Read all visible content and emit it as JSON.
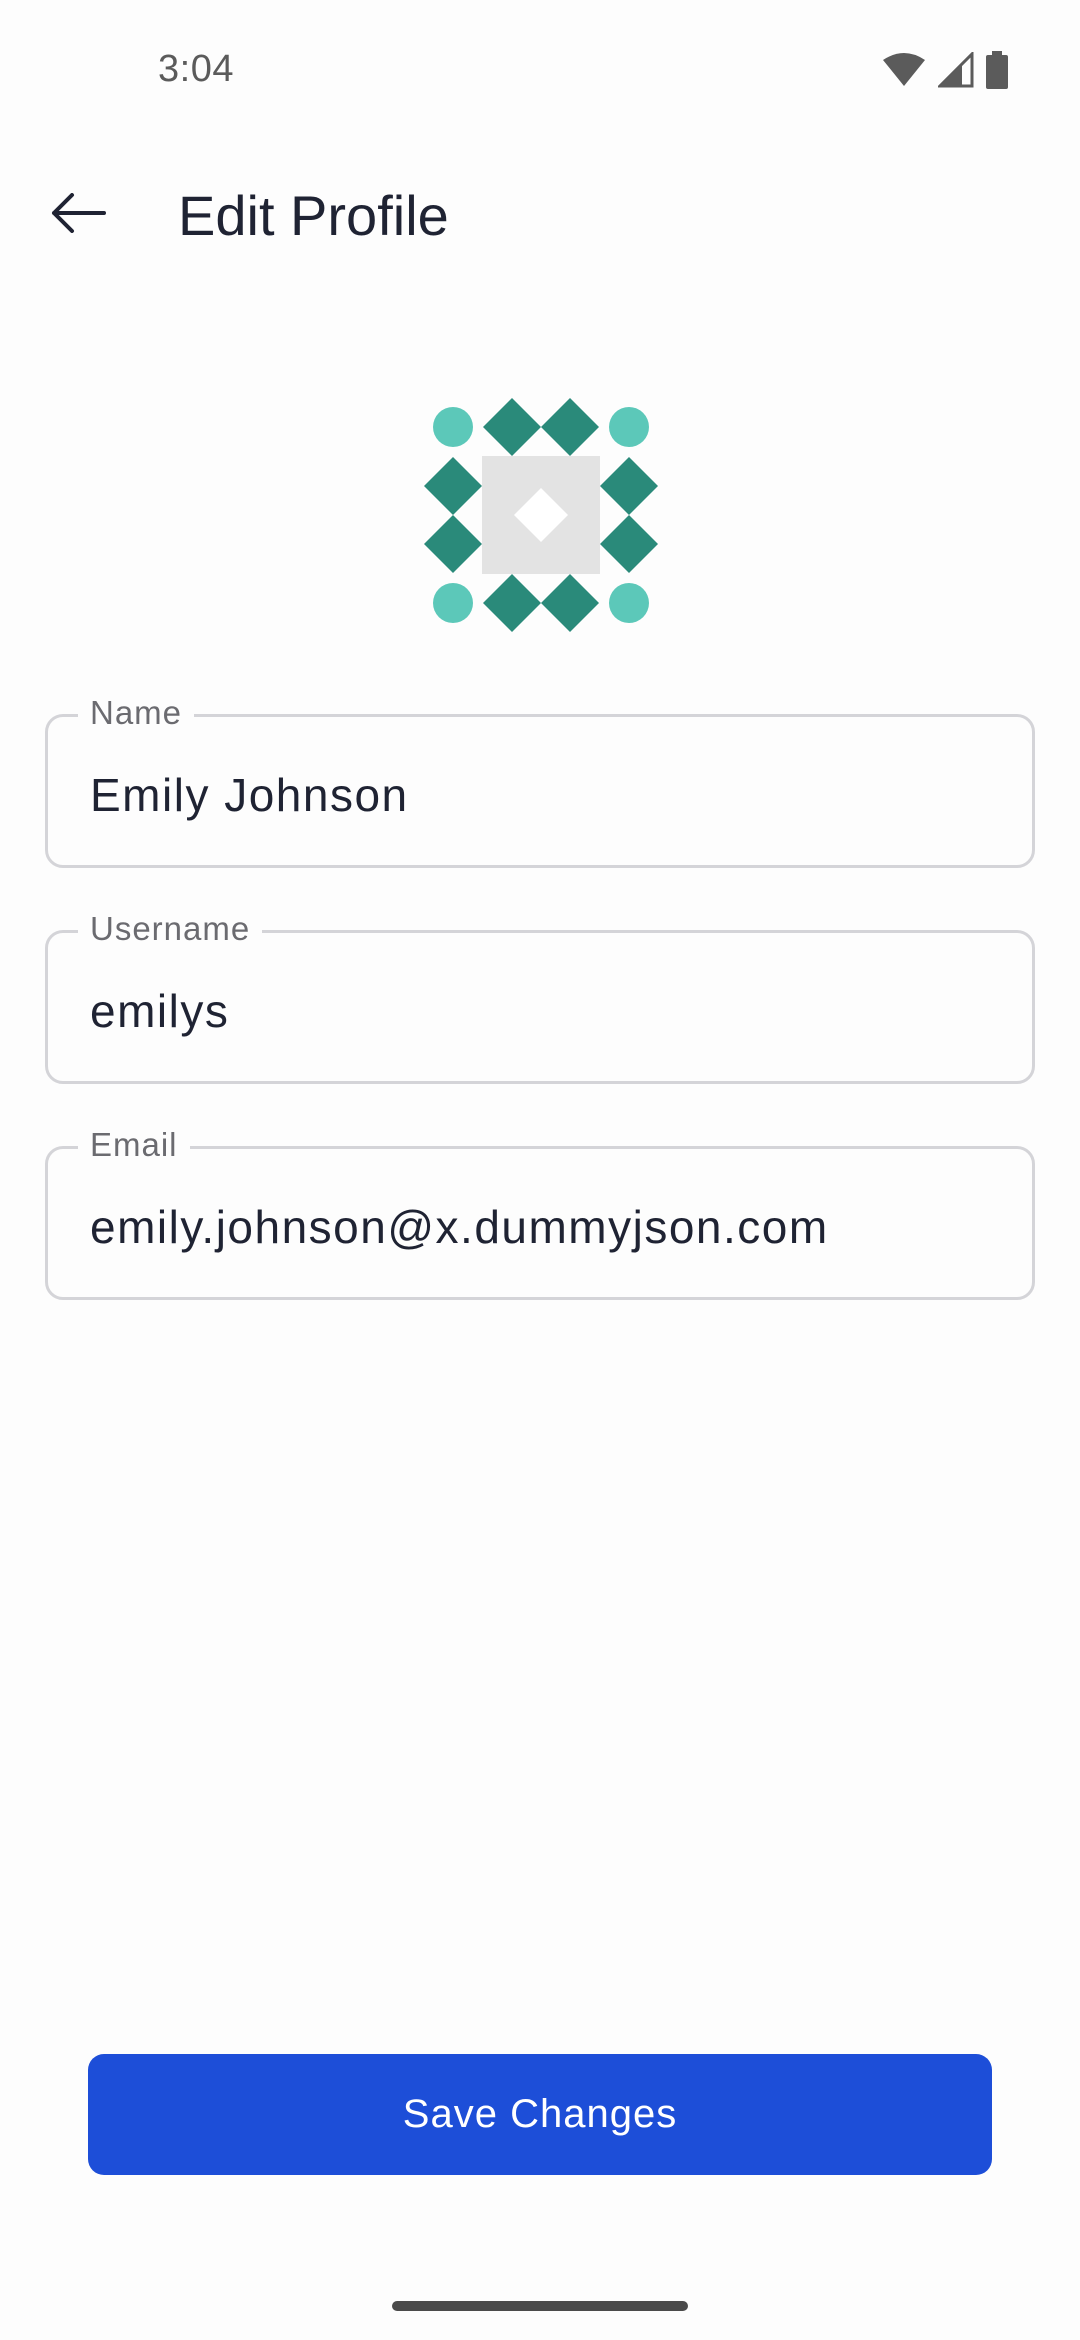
{
  "status_bar": {
    "time": "3:04",
    "icons": [
      "wifi-icon",
      "cellular-signal-icon",
      "battery-icon"
    ]
  },
  "app_bar": {
    "back_icon": "arrow-left-icon",
    "title": "Edit Profile"
  },
  "avatar": {
    "type": "identicon",
    "colors": {
      "dark": "#2a8a7a",
      "light": "#5cc8b9",
      "center_bg": "#e3e3e3",
      "center_mark": "#ffffff"
    }
  },
  "form": {
    "fields": [
      {
        "label": "Name",
        "value": "Emily Johnson"
      },
      {
        "label": "Username",
        "value": "emilys"
      },
      {
        "label": "Email",
        "value": "emily.johnson@x.dummyjson.com"
      }
    ]
  },
  "actions": {
    "save_label": "Save Changes"
  },
  "colors": {
    "primary": "#1d4ed8",
    "text": "#1f2333",
    "label": "#6b6b70",
    "outline": "#d4d4d8",
    "background": "#fdfdfd"
  }
}
